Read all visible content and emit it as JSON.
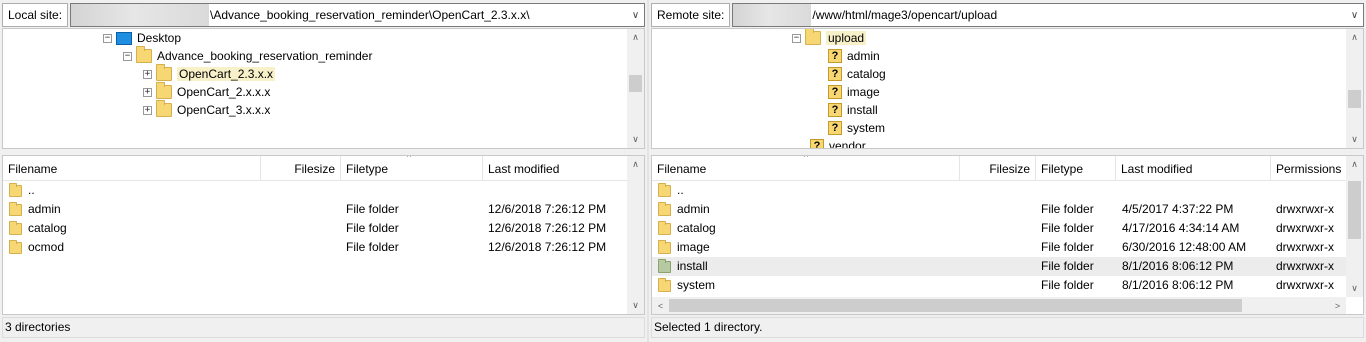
{
  "local": {
    "site_label": "Local site:",
    "path": "\\Advance_booking_reservation_reminder\\OpenCart_2.3.x.x\\",
    "tree": {
      "desktop": "Desktop",
      "project": "Advance_booking_reservation_reminder",
      "children": [
        "OpenCart_2.3.x.x",
        "OpenCart_2.x.x.x",
        "OpenCart_3.x.x.x"
      ]
    },
    "columns": {
      "filename": "Filename",
      "filesize": "Filesize",
      "filetype": "Filetype",
      "last_modified": "Last modified"
    },
    "rows": [
      {
        "name": "..",
        "type": "",
        "modified": ""
      },
      {
        "name": "admin",
        "type": "File folder",
        "modified": "12/6/2018 7:26:12 PM"
      },
      {
        "name": "catalog",
        "type": "File folder",
        "modified": "12/6/2018 7:26:12 PM"
      },
      {
        "name": "ocmod",
        "type": "File folder",
        "modified": "12/6/2018 7:26:12 PM"
      }
    ],
    "status": "3 directories"
  },
  "remote": {
    "site_label": "Remote site:",
    "path": "/www/html/mage3/opencart/upload",
    "tree": {
      "root": "upload",
      "children": [
        "admin",
        "catalog",
        "image",
        "install",
        "system"
      ],
      "sibling": "vendor",
      "unknown_marker": "?"
    },
    "columns": {
      "filename": "Filename",
      "filesize": "Filesize",
      "filetype": "Filetype",
      "last_modified": "Last modified",
      "permissions": "Permissions"
    },
    "rows": [
      {
        "name": "..",
        "type": "",
        "modified": "",
        "perms": ""
      },
      {
        "name": "admin",
        "type": "File folder",
        "modified": "4/5/2017 4:37:22 PM",
        "perms": "drwxrwxr-x"
      },
      {
        "name": "catalog",
        "type": "File folder",
        "modified": "4/17/2016 4:34:14 AM",
        "perms": "drwxrwxr-x"
      },
      {
        "name": "image",
        "type": "File folder",
        "modified": "6/30/2016 12:48:00 AM",
        "perms": "drwxrwxr-x"
      },
      {
        "name": "install",
        "type": "File folder",
        "modified": "8/1/2016 8:06:12 PM",
        "perms": "drwxrwxr-x"
      },
      {
        "name": "system",
        "type": "File folder",
        "modified": "8/1/2016 8:06:12 PM",
        "perms": "drwxrwxr-x"
      }
    ],
    "selected_row": "install",
    "status": "Selected 1 directory."
  },
  "icons": {
    "dropdown": "chevron-down-icon",
    "scroll_up": "chevron-up-icon",
    "scroll_down": "chevron-down-icon",
    "scroll_left": "chevron-left-icon",
    "scroll_right": "chevron-right-icon",
    "expand": "plus-icon",
    "collapse": "minus-icon",
    "folder": "folder-icon",
    "desktop": "desktop-icon",
    "unknown_folder": "question-folder-icon"
  },
  "colors": {
    "folder": "#f7d774",
    "desktop": "#1e8fe0",
    "selection": "#ececec",
    "tree_selection": "#f7f0c8"
  }
}
